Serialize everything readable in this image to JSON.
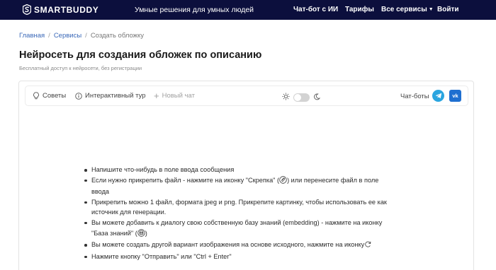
{
  "header": {
    "logo_text": "SMARTBUDDY",
    "tagline": "Умные решения для умных людей",
    "nav": {
      "chat": "Чат-бот с ИИ",
      "tariffs": "Тарифы",
      "services": "Все сервисы",
      "login": "Войти"
    }
  },
  "breadcrumb": {
    "home": "Главная",
    "services": "Сервисы",
    "current": "Создать обложку",
    "separator": "/"
  },
  "page": {
    "title": "Нейросеть для создания обложек по описанию",
    "subtitle": "Бесплатный доступ к нейросети, без регистрации"
  },
  "toolbar": {
    "tips": "Советы",
    "tour": "Интерактивный тур",
    "new_chat": "Новый чат",
    "chatbots": "Чат-боты",
    "vk": "vk"
  },
  "tips": [
    {
      "text": "Напишите что-нибудь в поле ввода сообщения"
    },
    {
      "text_before": "Если нужно прикрепить файл - нажмите на иконку \"Скрепка\" (",
      "icon": "paperclip-icon",
      "text_after": ") или перенесите файл в поле ввода"
    },
    {
      "text": "Прикрепить можно 1 файл, формата jpeg и png. Прикрепите картинку, чтобы использовать ее как источник для генерации."
    },
    {
      "text_before": "Вы можете добавить к диалогу свою собственную базу знаний (embedding) - нажмите на иконку \"База знаний\" (",
      "icon": "database-icon",
      "text_after": ")"
    },
    {
      "text_before": "Вы можете создать другой вариант изображения на основе исходного, нажмите на иконку",
      "icon": "regenerate-icon",
      "text_after": ""
    },
    {
      "text": "Нажмите кнопку \"Отправить\" или \"Ctrl + Enter\""
    }
  ],
  "colors": {
    "header_bg": "#0c0f3d",
    "link": "#3a68b8",
    "telegram": "#2aa5e0",
    "vk": "#1f6fd0"
  }
}
